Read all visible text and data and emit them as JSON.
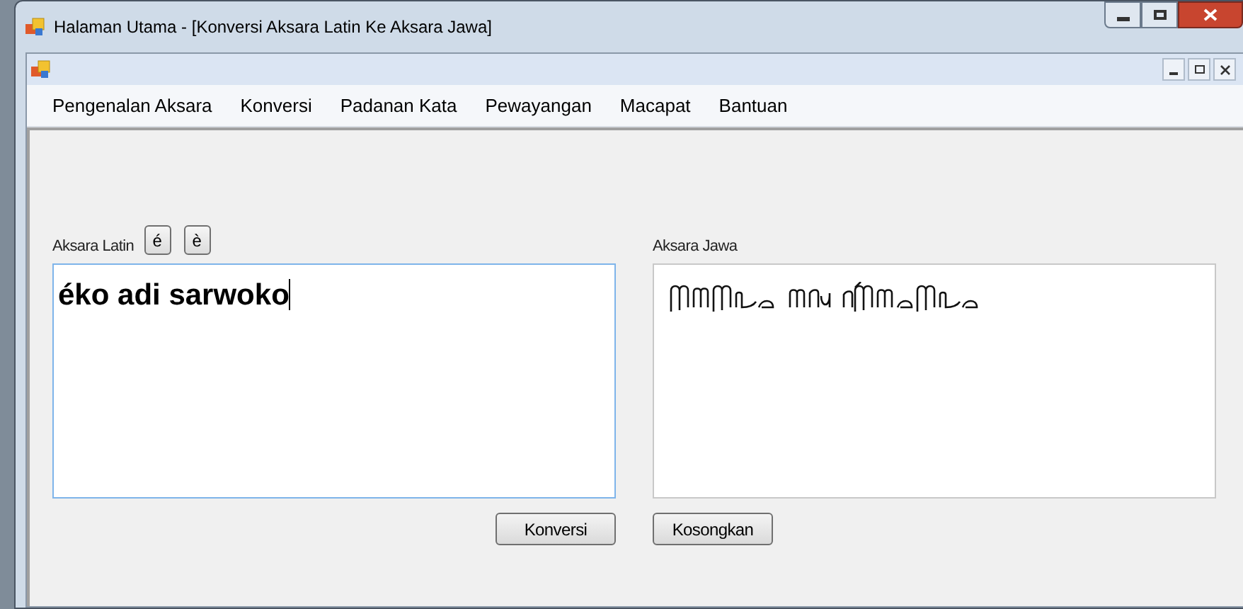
{
  "window": {
    "title": "Halaman Utama - [Konversi Aksara Latin Ke Aksara Jawa]"
  },
  "menu": [
    "Pengenalan Aksara",
    "Konversi",
    "Padanan Kata",
    "Pewayangan",
    "Macapat",
    "Bantuan"
  ],
  "latin": {
    "label": "Aksara Latin",
    "accent_buttons": [
      "é",
      "è"
    ],
    "value": "éko adi sarwoko"
  },
  "jawa": {
    "label": "Aksara Jawa"
  },
  "buttons": [
    "Konversi",
    "Kosongkan"
  ]
}
